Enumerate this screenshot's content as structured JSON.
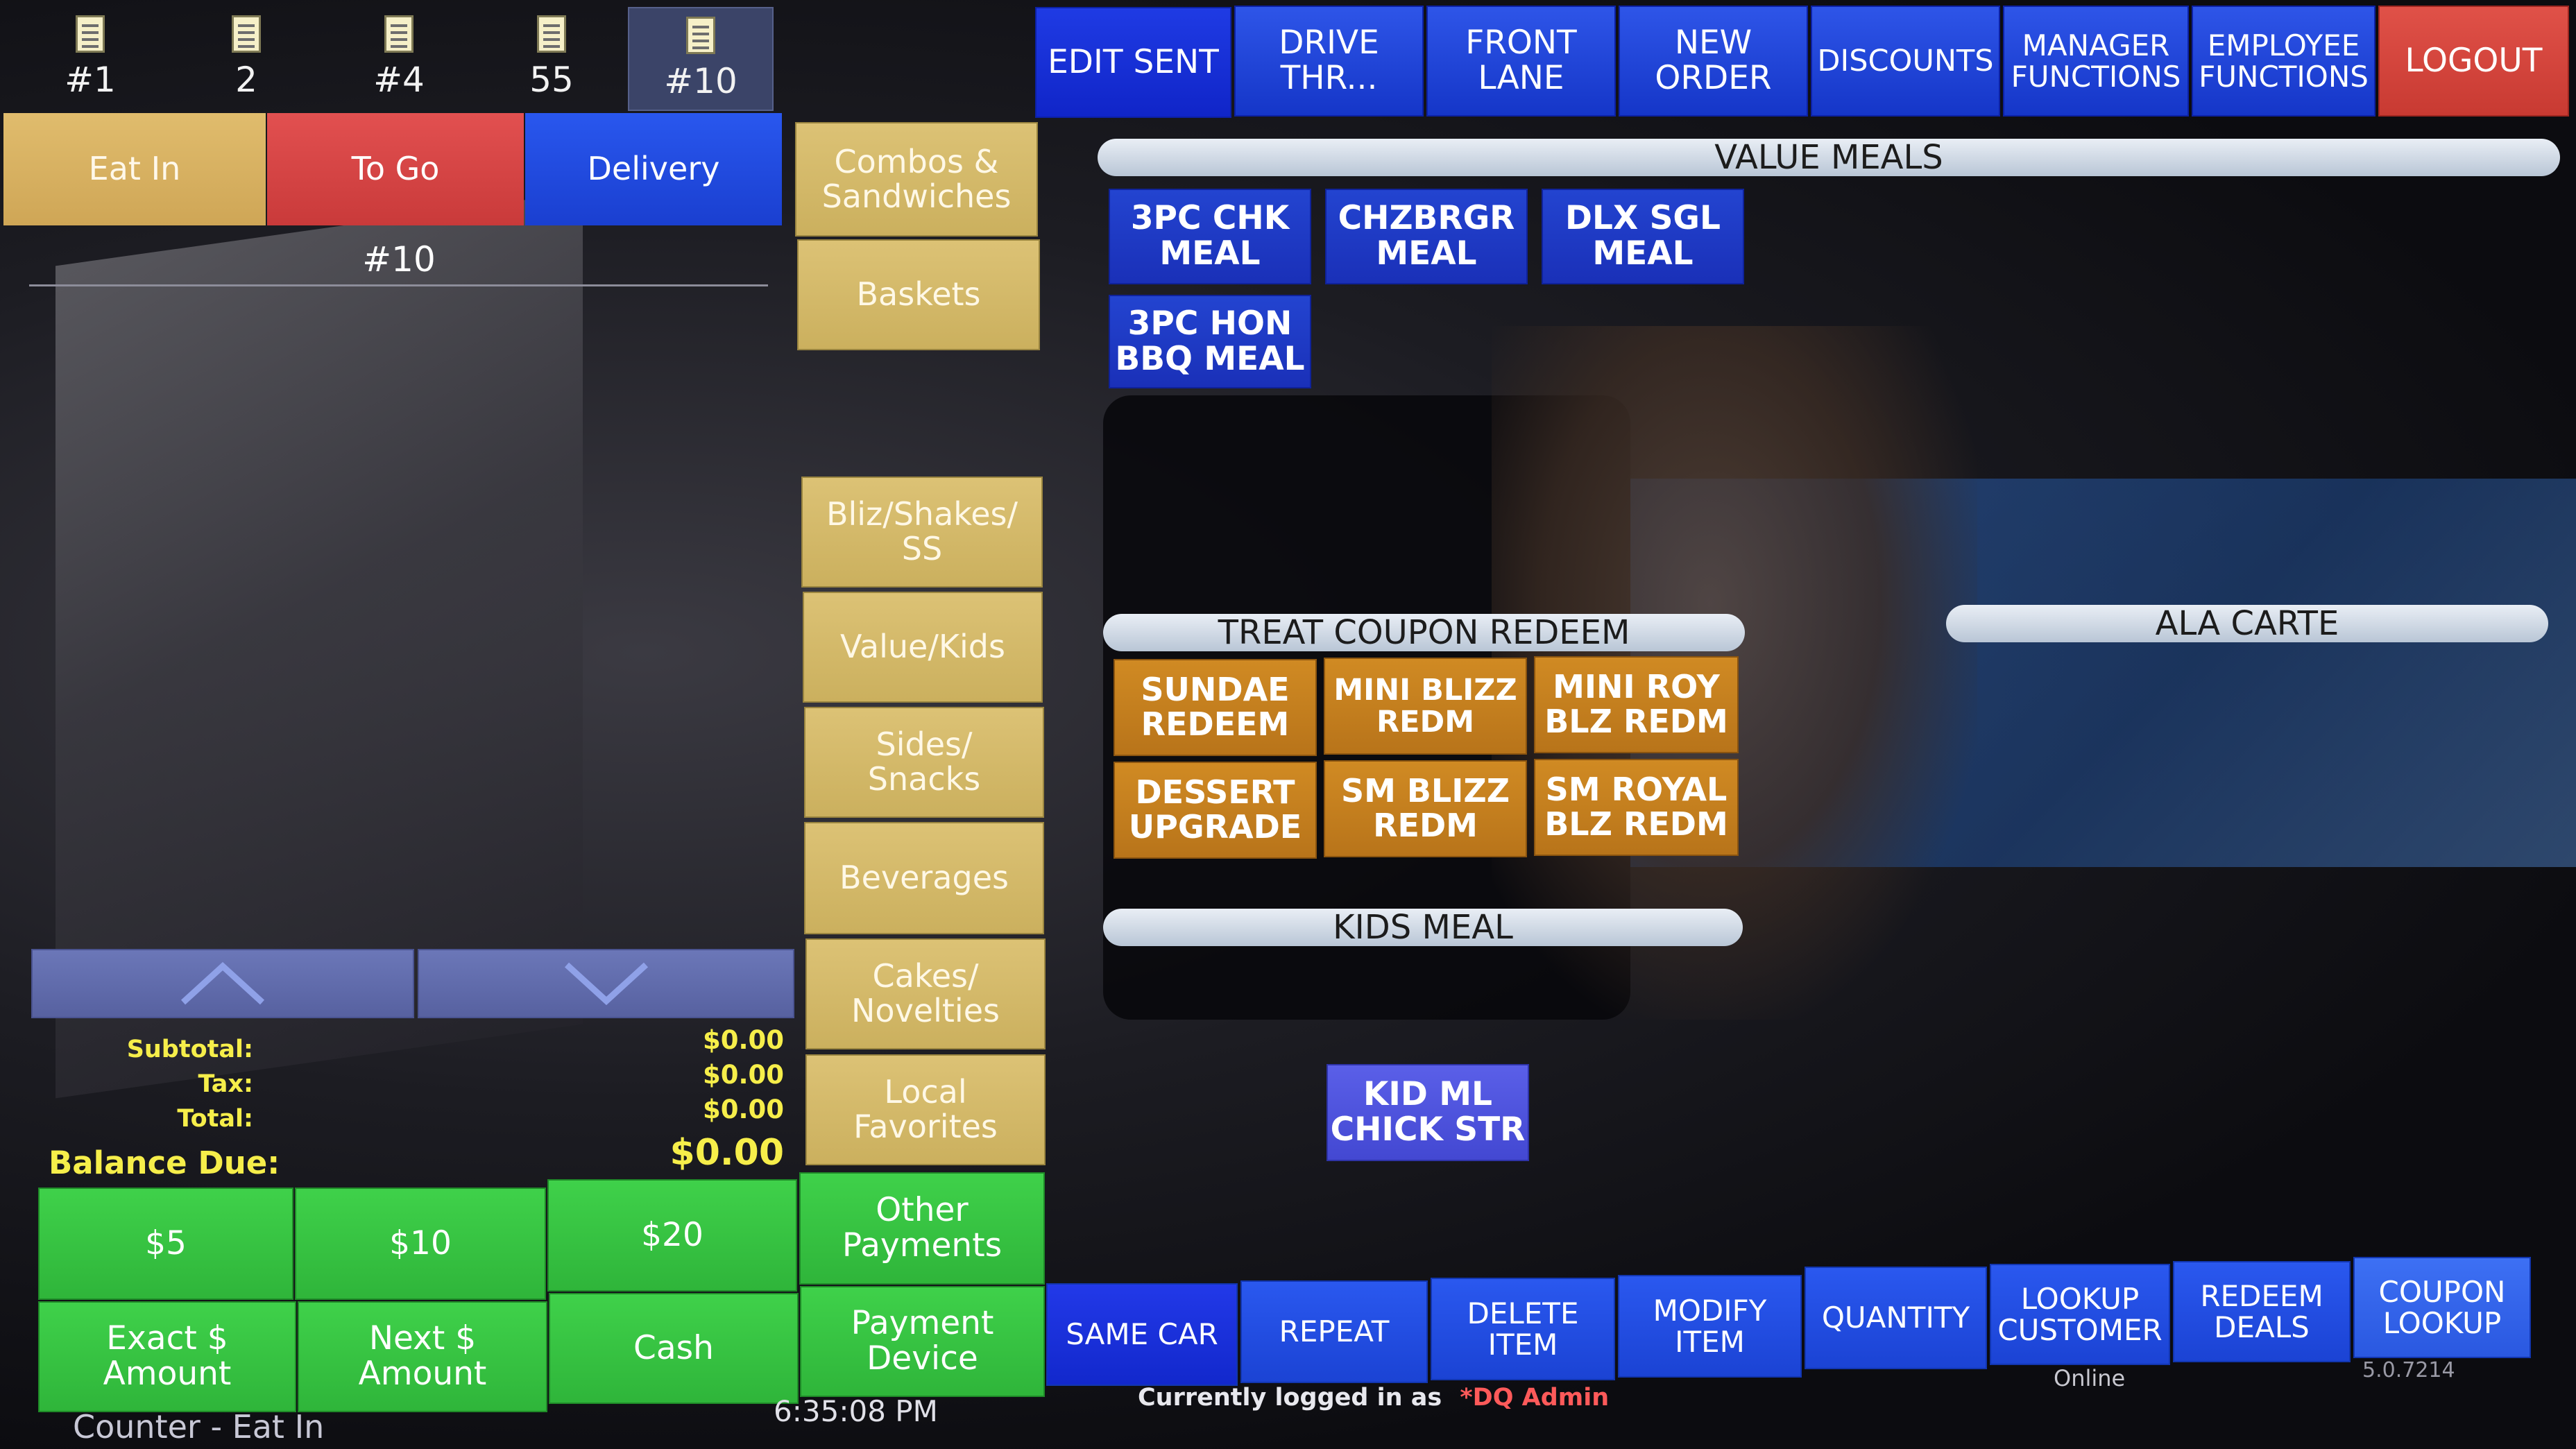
{
  "tickets": [
    {
      "label": "#1"
    },
    {
      "label": "2"
    },
    {
      "label": "#4"
    },
    {
      "label": "55"
    },
    {
      "label": "#10"
    }
  ],
  "order_types": {
    "eat_in": "Eat In",
    "to_go": "To Go",
    "delivery": "Delivery"
  },
  "current_order": "#10",
  "categories": {
    "combos": "Combos &\nSandwiches",
    "baskets": "Baskets",
    "bliz": "Bliz/Shakes/\nSS",
    "value_kids": "Value/Kids",
    "sides": "Sides/\nSnacks",
    "beverages": "Beverages",
    "cakes": "Cakes/\nNovelties",
    "local": "Local\nFavorites"
  },
  "top_nav": {
    "edit_sent": "EDIT SENT",
    "drive_thru": "DRIVE\nTHR...",
    "front_lane": "FRONT\nLANE",
    "new_order": "NEW\nORDER",
    "discounts": "DISCOUNTS",
    "manager": "MANAGER\nFUNCTIONS",
    "employee": "EMPLOYEE\nFUNCTIONS",
    "logout": "LOGOUT"
  },
  "sections": {
    "value_meals": {
      "title": "VALUE MEALS",
      "items": [
        "3PC CHK\nMEAL",
        "CHZBRGR\nMEAL",
        "DLX SGL\nMEAL",
        "3PC HON\nBBQ MEAL"
      ]
    },
    "treat_coupon": {
      "title": "TREAT COUPON REDEEM",
      "items": [
        "SUNDAE\nREDEEM",
        "MINI BLIZZ\nREDM",
        "MINI ROY\nBLZ REDM",
        "DESSERT\nUPGRADE",
        "SM BLIZZ\nREDM",
        "SM ROYAL\nBLZ REDM"
      ]
    },
    "ala_carte": {
      "title": "ALA CARTE"
    },
    "kids_meal": {
      "title": "KIDS MEAL",
      "items": [
        "KID ML\nCHICK STR"
      ]
    }
  },
  "totals": {
    "subtotal_label": "Subtotal:",
    "tax_label": "Tax:",
    "total_label": "Total:",
    "balance_label": "Balance Due:",
    "subtotal": "$0.00",
    "tax": "$0.00",
    "total": "$0.00",
    "balance": "$0.00"
  },
  "payments": {
    "five": "$5",
    "ten": "$10",
    "twenty": "$20",
    "other": "Other\nPayments",
    "exact": "Exact $\nAmount",
    "next": "Next $\nAmount",
    "cash": "Cash",
    "device": "Payment\nDevice"
  },
  "bottom_nav": {
    "same_car": "SAME CAR",
    "repeat": "REPEAT",
    "delete_item": "DELETE\nITEM",
    "modify_item": "MODIFY\nITEM",
    "quantity": "QUANTITY",
    "lookup_customer": "LOOKUP\nCUSTOMER",
    "redeem_deals": "REDEEM\nDEALS",
    "coupon_lookup": "COUPON\nLOOKUP"
  },
  "status": {
    "mode": "Counter - Eat In",
    "time": "6:35:08 PM",
    "logged_in_prefix": "Currently logged in as",
    "user": "*DQ Admin",
    "online": "Online",
    "version": "5.0.7214"
  },
  "colors": {
    "eat_in": "#d9b360",
    "to_go": "#d94646",
    "delivery": "#1f4be0",
    "category": "#d4ba6a",
    "nav_blue": "#1f44d8",
    "logout": "#d8473e",
    "treat": "#c5801f",
    "pay_green": "#38c443",
    "totals_yellow": "#f6ee4a"
  }
}
